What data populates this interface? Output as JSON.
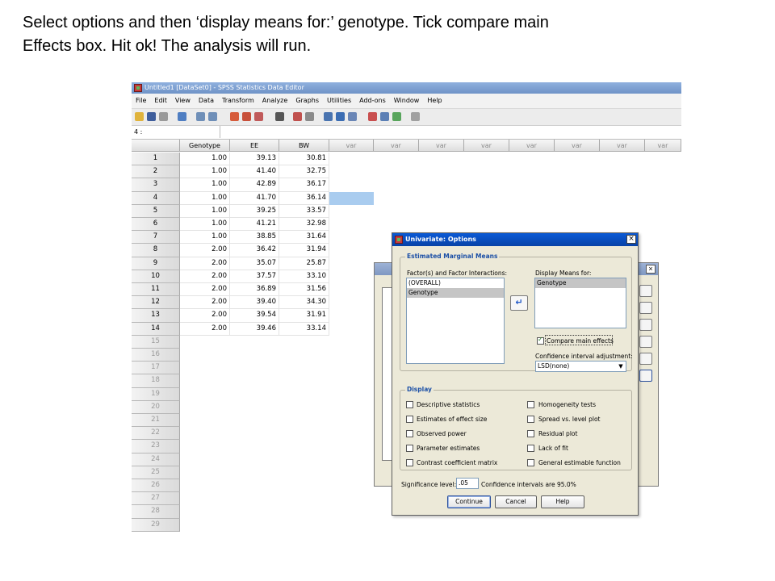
{
  "caption": {
    "line1": "Select options and then ‘display means for:’ genotype. Tick compare main",
    "line2": "Effects box. Hit ok! The analysis will run."
  },
  "window": {
    "title": "Untitled1 [DataSet0] - SPSS Statistics Data Editor",
    "menu": [
      "File",
      "Edit",
      "View",
      "Data",
      "Transform",
      "Analyze",
      "Graphs",
      "Utilities",
      "Add-ons",
      "Window",
      "Help"
    ],
    "cell_ref": "4 :"
  },
  "grid": {
    "columns": [
      "Genotype",
      "EE",
      "BW",
      "var",
      "var",
      "var",
      "var",
      "var",
      "var",
      "var",
      "var"
    ],
    "rows": [
      [
        "1",
        "1.00",
        "39.13",
        "30.81"
      ],
      [
        "2",
        "1.00",
        "41.40",
        "32.75"
      ],
      [
        "3",
        "1.00",
        "42.89",
        "36.17"
      ],
      [
        "4",
        "1.00",
        "41.70",
        "36.14"
      ],
      [
        "5",
        "1.00",
        "39.25",
        "33.57"
      ],
      [
        "6",
        "1.00",
        "41.21",
        "32.98"
      ],
      [
        "7",
        "1.00",
        "38.85",
        "31.64"
      ],
      [
        "8",
        "2.00",
        "36.42",
        "31.94"
      ],
      [
        "9",
        "2.00",
        "35.07",
        "25.87"
      ],
      [
        "10",
        "2.00",
        "37.57",
        "33.10"
      ],
      [
        "11",
        "2.00",
        "36.89",
        "31.56"
      ],
      [
        "12",
        "2.00",
        "39.40",
        "34.30"
      ],
      [
        "13",
        "2.00",
        "39.54",
        "31.91"
      ],
      [
        "14",
        "2.00",
        "39.46",
        "33.14"
      ]
    ],
    "empty_rows": [
      "15",
      "16",
      "17",
      "18",
      "19",
      "20",
      "21",
      "22",
      "23",
      "24",
      "25",
      "26",
      "27",
      "28",
      "29"
    ]
  },
  "background_dialog": {
    "title": "U"
  },
  "options_dialog": {
    "title": "Univariate: Options",
    "close": "×",
    "emm_group": "Estimated Marginal Means",
    "factors_label": "Factor(s) and Factor Interactions:",
    "factors": [
      "(OVERALL)",
      "Genotype"
    ],
    "display_means_label": "Display Means for:",
    "display_means": [
      "Genotype"
    ],
    "move_arrow": "↵",
    "compare_main_effects": "Compare main effects",
    "ci_adjustment_label": "Confidence interval adjustment:",
    "ci_adjustment_value": "LSD(none)",
    "display_group": "Display",
    "display_left": [
      "Descriptive statistics",
      "Estimates of effect size",
      "Observed power",
      "Parameter estimates",
      "Contrast coefficient matrix"
    ],
    "display_right": [
      "Homogeneity tests",
      "Spread vs. level plot",
      "Residual plot",
      "Lack of fit",
      "General estimable function"
    ],
    "significance_label": "Significance level:",
    "significance_value": ".05",
    "ci_note": "Confidence intervals are 95.0%",
    "buttons": {
      "continue": "Continue",
      "cancel": "Cancel",
      "help": "Help"
    }
  }
}
